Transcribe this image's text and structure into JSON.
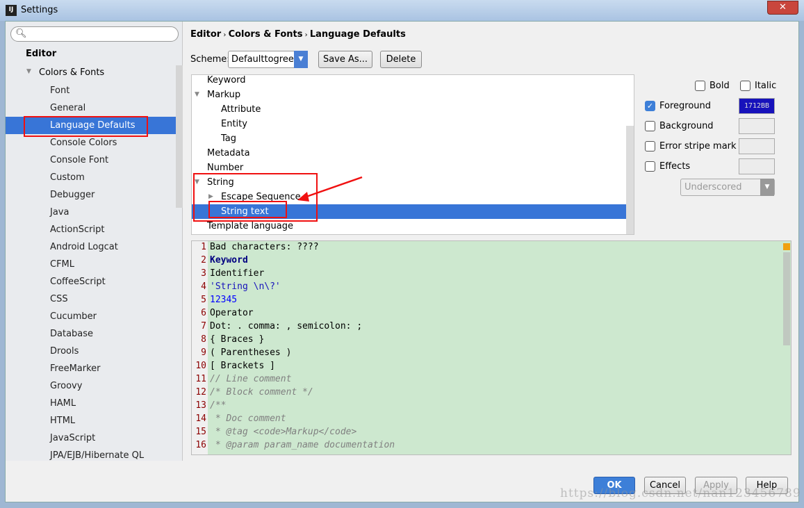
{
  "window": {
    "title": "Settings",
    "app_icon": "IJ",
    "close": "✕"
  },
  "sidebar": {
    "search_placeholder": "",
    "section": "Editor",
    "group": "Colors & Fonts",
    "items": [
      "Font",
      "General",
      "Language Defaults",
      "Console Colors",
      "Console Font",
      "Custom",
      "Debugger",
      "Java",
      "ActionScript",
      "Android Logcat",
      "CFML",
      "CoffeeScript",
      "CSS",
      "Cucumber",
      "Database",
      "Drools",
      "FreeMarker",
      "Groovy",
      "HAML",
      "HTML",
      "JavaScript",
      "JPA/EJB/Hibernate QL"
    ],
    "selected": "Language Defaults"
  },
  "breadcrumb": [
    "Editor",
    "Colors & Fonts",
    "Language Defaults"
  ],
  "scheme": {
    "label": "Scheme:",
    "value": "Defaulttogreen",
    "save_as": "Save As...",
    "delete": "Delete"
  },
  "tree": [
    {
      "label": "Keyword",
      "level": 0,
      "arrow": ""
    },
    {
      "label": "Markup",
      "level": 0,
      "arrow": "▼"
    },
    {
      "label": "Attribute",
      "level": 1,
      "arrow": ""
    },
    {
      "label": "Entity",
      "level": 1,
      "arrow": ""
    },
    {
      "label": "Tag",
      "level": 1,
      "arrow": ""
    },
    {
      "label": "Metadata",
      "level": 0,
      "arrow": ""
    },
    {
      "label": "Number",
      "level": 0,
      "arrow": ""
    },
    {
      "label": "String",
      "level": 0,
      "arrow": "▼"
    },
    {
      "label": "Escape Sequence",
      "level": 1,
      "arrow": "▶"
    },
    {
      "label": "String text",
      "level": 1,
      "arrow": "",
      "selected": true
    },
    {
      "label": "Template language",
      "level": 0,
      "arrow": ""
    }
  ],
  "attributes": {
    "bold": {
      "label": "Bold",
      "checked": false
    },
    "italic": {
      "label": "Italic",
      "checked": false
    },
    "foreground": {
      "label": "Foreground",
      "checked": true,
      "color": "1712BB",
      "hex": "#1712BB"
    },
    "background": {
      "label": "Background",
      "checked": false
    },
    "error_stripe": {
      "label": "Error stripe mark",
      "checked": false
    },
    "effects": {
      "label": "Effects",
      "checked": false,
      "type": "Underscored"
    }
  },
  "preview": {
    "lines": [
      "Bad characters: ????",
      "Keyword",
      "Identifier",
      "'String \\n\\?'",
      "12345",
      "Operator",
      "Dot: . comma: , semicolon: ;",
      "{ Braces }",
      "( Parentheses )",
      "[ Brackets ]",
      "// Line comment",
      "/* Block comment */",
      "/**",
      " * Doc comment",
      " * @tag <code>Markup</code>",
      " * @param param_name documentation"
    ],
    "background": "#CDE8CF"
  },
  "buttons": {
    "ok": "OK",
    "cancel": "Cancel",
    "apply": "Apply",
    "help": "Help"
  },
  "watermark": "https://blog.csdn.net/nan123456789"
}
